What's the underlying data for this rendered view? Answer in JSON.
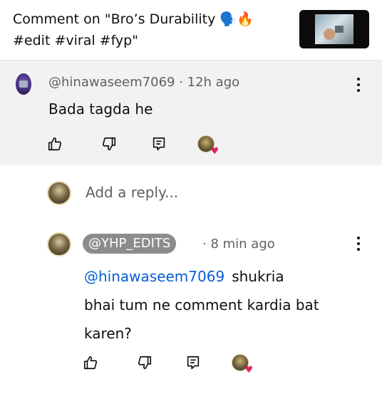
{
  "header": {
    "title_line1": "Comment on \"Bro’s Durability 🗣️🔥",
    "title_line2": "#edit #viral #fyp\""
  },
  "parent_comment": {
    "handle": "@hinawaseem7069",
    "separator": " · ",
    "time": "12h ago",
    "text": "Bada tagda he"
  },
  "reply_input": {
    "placeholder": "Add a reply..."
  },
  "reply": {
    "handle": "@YHP_EDITS",
    "separator": " · ",
    "time": "8 min ago",
    "mention": "@hinawaseem7069",
    "text_after_mention": "shukria",
    "text_rest": "bhai tum ne comment kardia bat karen?"
  },
  "icons": {
    "like": "thumbs-up-icon",
    "dislike": "thumbs-down-icon",
    "reply": "reply-icon",
    "creator_heart": "creator-heart-icon",
    "menu": "more-vert-icon"
  },
  "colors": {
    "mention": "#065fd4",
    "heart": "#e0245e",
    "pill": "#8c8c8c",
    "parent_bg": "#f2f2f2"
  }
}
